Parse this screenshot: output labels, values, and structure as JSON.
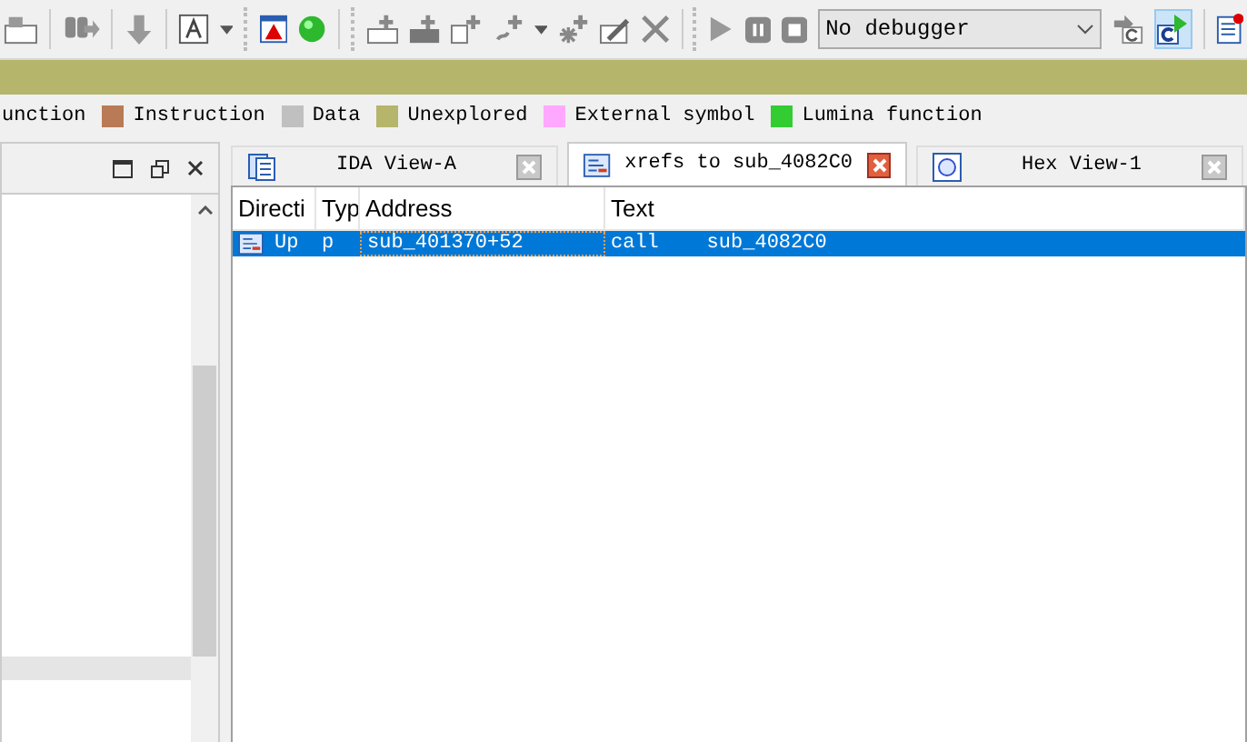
{
  "toolbar": {
    "debugger_select": {
      "value": "No debugger"
    }
  },
  "legend": [
    {
      "label": "unction"
    },
    {
      "label": "Instruction",
      "color": "#b97a57"
    },
    {
      "label": "Data",
      "color": "#c0c0c0"
    },
    {
      "label": "Unexplored",
      "color": "#b5b56b"
    },
    {
      "label": "External symbol",
      "color": "#ffa8ff"
    },
    {
      "label": "Lumina function",
      "color": "#33cc33"
    }
  ],
  "tabs": [
    {
      "label": "IDA View-A",
      "selected": false,
      "kind": "disasm"
    },
    {
      "label": "xrefs to sub_4082C0",
      "selected": true,
      "kind": "xrefs"
    },
    {
      "label": "Hex View-1",
      "selected": false,
      "kind": "hex"
    }
  ],
  "table": {
    "columns": [
      "Directi",
      "Typ",
      "Address",
      "Text"
    ],
    "rows": [
      {
        "cells": [
          "Up",
          "p",
          "sub_401370+52",
          "call    sub_4082C0"
        ],
        "selected": true
      }
    ]
  }
}
